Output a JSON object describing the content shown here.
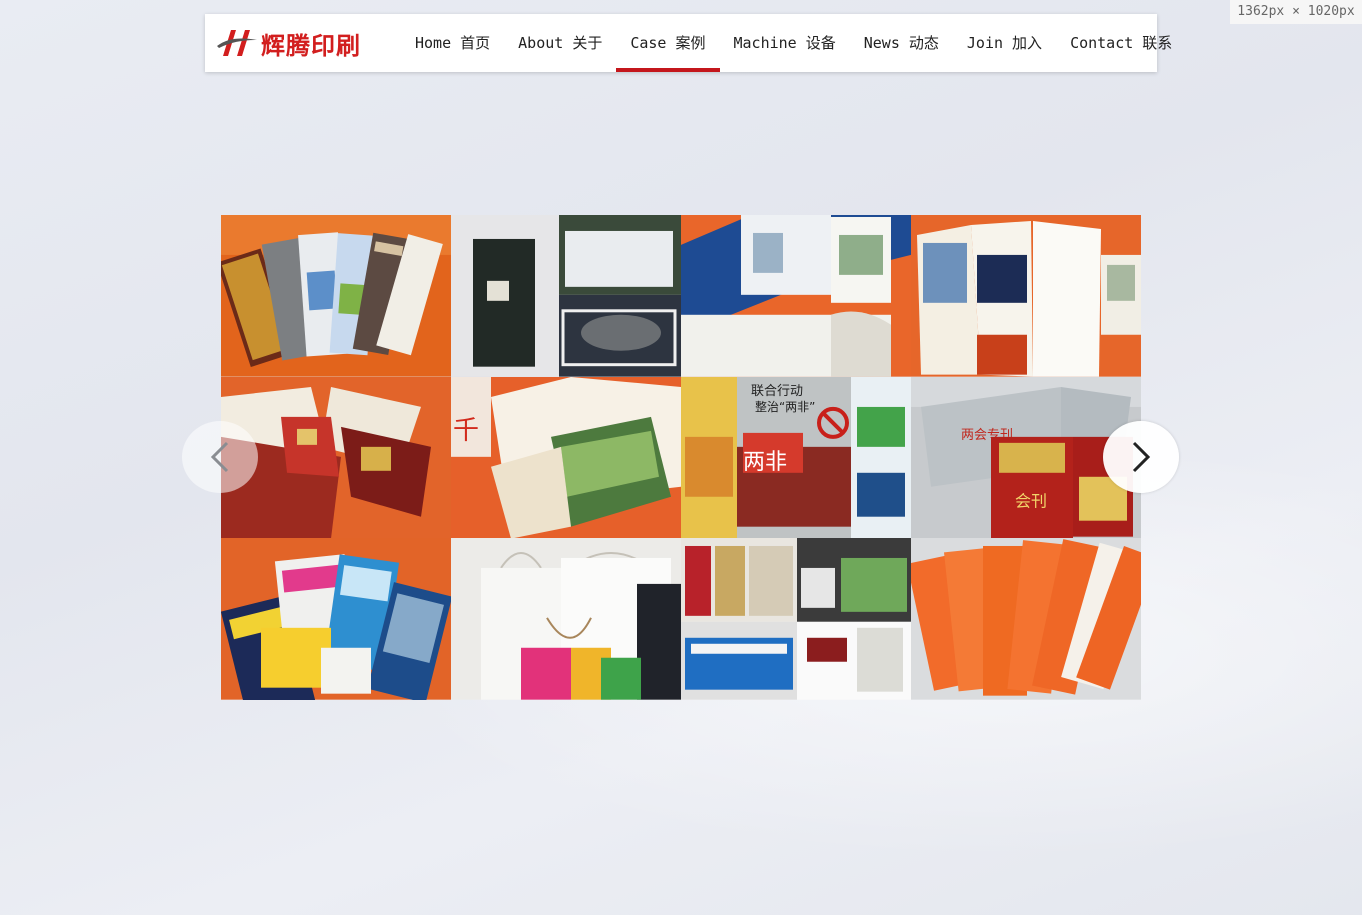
{
  "viewport_badge": "1362px × 1020px",
  "brand": {
    "logo_text": "辉腾印刷",
    "logo_color": "#d21e1e",
    "accent_color": "#c4161c"
  },
  "nav": {
    "items": [
      {
        "label": "Home 首页"
      },
      {
        "label": "About 关于"
      },
      {
        "label": "Case 案例",
        "active": true
      },
      {
        "label": "Machine 设备"
      },
      {
        "label": "News 动态"
      },
      {
        "label": "Join 加入"
      },
      {
        "label": "Contact 联系"
      }
    ]
  },
  "gallery": {
    "controls": {
      "prev_icon": "chevron-left-icon",
      "next_icon": "chevron-right-icon"
    },
    "tiles": [
      {
        "name": "brochure-fan-orange"
      },
      {
        "name": "hardcover-books"
      },
      {
        "name": "folders-blue"
      },
      {
        "name": "trifold-brochure"
      },
      {
        "name": "booklets-red"
      },
      {
        "name": "catalog-open"
      },
      {
        "name": "posters-set",
        "text": [
          "联合行动",
          "整治“两非”",
          "两非"
        ]
      },
      {
        "name": "conference-books",
        "text": [
          "两会专刊",
          "会刊"
        ]
      },
      {
        "name": "magazines-pile"
      },
      {
        "name": "paper-bags"
      },
      {
        "name": "desk-calendars"
      },
      {
        "name": "orange-envelopes"
      }
    ]
  }
}
